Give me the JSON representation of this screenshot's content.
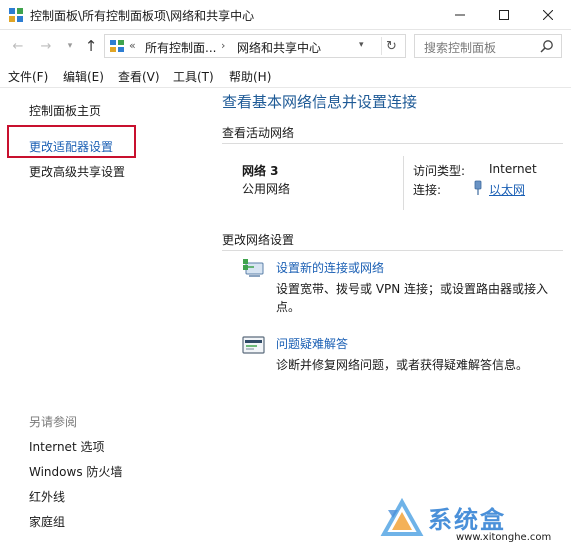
{
  "window": {
    "title": "控制面板\\所有控制面板项\\网络和共享中心",
    "app_icon": "control-panel-icon"
  },
  "address_bar": {
    "chevrons": "«",
    "segment1": "所有控制面...",
    "separator": "›",
    "segment2": "网络和共享中心"
  },
  "search": {
    "placeholder": "搜索控制面板"
  },
  "menu": {
    "items": [
      "文件(F)",
      "编辑(E)",
      "查看(V)",
      "工具(T)",
      "帮助(H)"
    ]
  },
  "left_pane": {
    "home": "控制面板主页",
    "adapter": "更改适配器设置",
    "sharing": "更改高级共享设置",
    "see_also_title": "另请参阅",
    "see_also": [
      "Internet 选项",
      "Windows 防火墙",
      "红外线",
      "家庭组"
    ]
  },
  "main": {
    "title": "查看基本网络信息并设置连接",
    "active_networks_head": "查看活动网络",
    "network_name": "网络  3",
    "network_type": "公用网络",
    "access_type_label": "访问类型:",
    "access_type_value": "Internet",
    "connection_label": "连接:",
    "connection_value": "以太网",
    "change_settings_head": "更改网络设置",
    "tasks": [
      {
        "link": "设置新的连接或网络",
        "desc": "设置宽带、拨号或 VPN 连接；或设置路由器或接入点。",
        "icon": "new-connection-icon"
      },
      {
        "link": "问题疑难解答",
        "desc": "诊断并修复网络问题，或者获得疑难解答信息。",
        "icon": "troubleshoot-icon"
      }
    ]
  },
  "watermark": {
    "title": "系统盒",
    "url": "www.xitonghe.com"
  },
  "colors": {
    "link": "#1a5fb4",
    "title": "#1e5a96",
    "highlight_box": "#c8102e",
    "watermark": "#4a90d9"
  }
}
